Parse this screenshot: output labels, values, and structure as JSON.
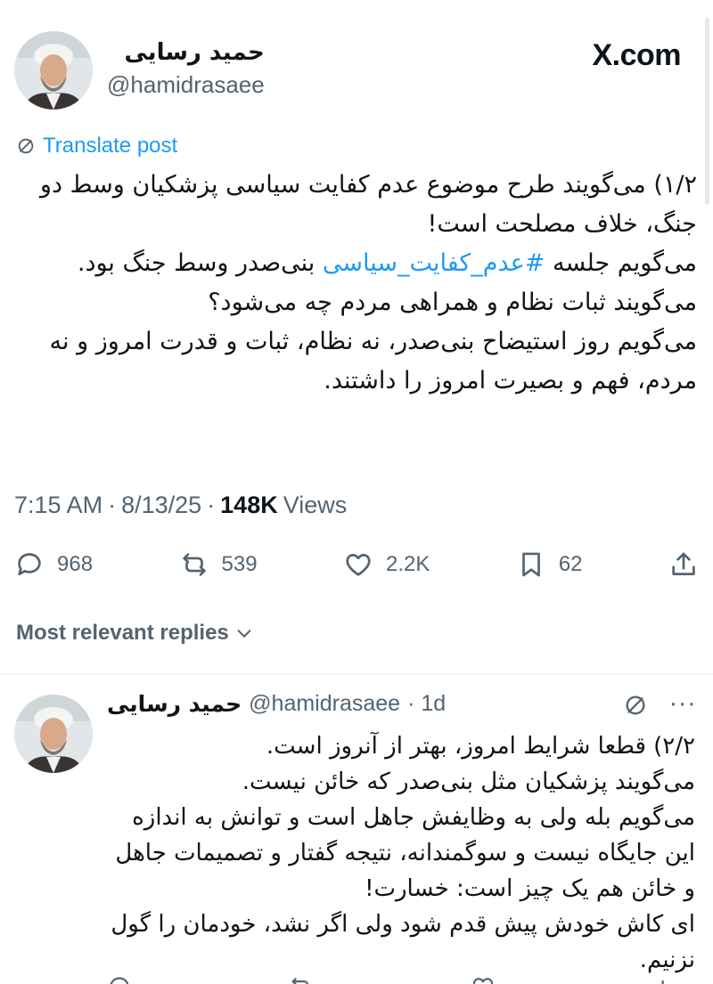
{
  "site_logo": "X.com",
  "post": {
    "display_name": "حمید رسایی",
    "handle": "@hamidrasaee",
    "translate_label": "Translate post",
    "paragraphs": [
      "۱/۲) می‌گویند طرح موضوع عدم کفایت سیاسی پزشکیان وسط دو جنگ، خلاف مصلحت است!",
      "می‌گویند ثبات نظام و همراهی مردم چه می‌شود؟",
      "می‌گویم روز استیضاح بنی‌صدر، نه نظام، ثبات و قدرت امروز و نه مردم، فهم و بصیرت امروز را داشتند."
    ],
    "line2_before": "می‌گویم جلسه ",
    "hashtag": "#عدم_کفایت_سیاسی",
    "line2_after": " بنی‌صدر وسط جنگ بود.",
    "time": "7:15 AM",
    "separator": "·",
    "date": "8/13/25",
    "views_count": "148K",
    "views_label": "Views",
    "replies": "968",
    "reposts": "539",
    "likes": "2.2K",
    "bookmarks": "62"
  },
  "replies_sort": {
    "label": "Most relevant replies"
  },
  "reply": {
    "display_name": "حمید رسایی",
    "handle": "@hamidrasaee",
    "age": "· 1d",
    "more": "···",
    "lines": [
      "۲/۲) قطعا شرایط امروز، بهتر از آنروز است.",
      "می‌گویند پزشکیان مثل بنی‌صدر که خائن نیست.",
      "می‌گویم بله ولی به وظایفش جاهل است و توانش به اندازه این جایگاه نیست و سوگمندانه، نتیجه گفتار و تصمیمات جاهل و خائن هم یک چیز است: خسارت!",
      "ای کاش خودش پیش قدم شود ولی اگر نشد، خودمان را گول نزنیم."
    ]
  },
  "colors": {
    "accent": "#1d9bf0",
    "muted": "#536471",
    "text": "#0f1419"
  }
}
